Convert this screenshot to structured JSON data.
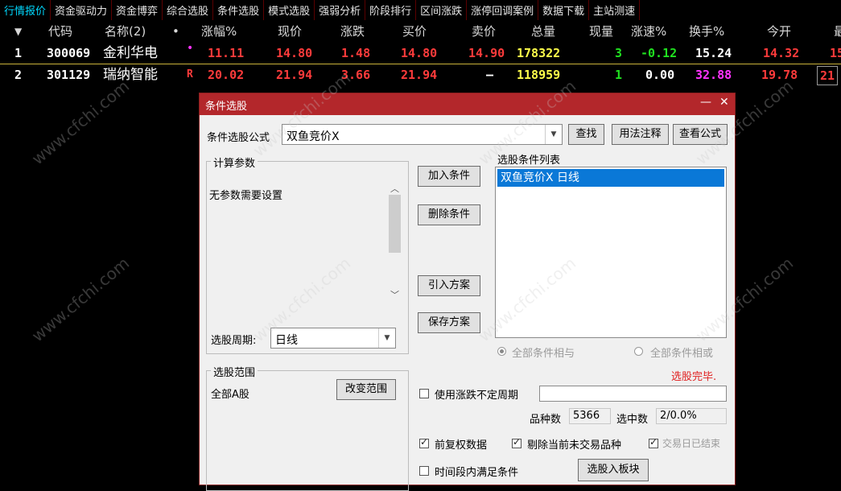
{
  "tabs": [
    "行情报价",
    "资金驱动力",
    "资金博弈",
    "综合选股",
    "条件选股",
    "模式选股",
    "强弱分析",
    "阶段排行",
    "区间涨跌",
    "涨停回调案例",
    "数据下载",
    "主站测速"
  ],
  "quote_table": {
    "sort_arrow": "▼",
    "headers": [
      "代码",
      "名称(2)",
      "•",
      "涨幅%",
      "现价",
      "涨跌",
      "买价",
      "卖价",
      "总量",
      "现量",
      "涨速%",
      "换手%",
      "今开",
      "最"
    ],
    "rows": [
      {
        "no": "1",
        "code": "300069",
        "name": "金利华电",
        "flag": "•",
        "change_pct": "11.11",
        "price": "14.80",
        "change": "1.48",
        "bid": "14.80",
        "ask": "14.90",
        "volume": "178322",
        "cur_vol": "3",
        "speed": "-0.12",
        "turnover": "15.24",
        "open": "14.32",
        "high": "15"
      },
      {
        "no": "2",
        "code": "301129",
        "name": "瑞纳智能",
        "flag": "R",
        "change_pct": "20.02",
        "price": "21.94",
        "change": "3.66",
        "bid": "21.94",
        "ask": "–",
        "volume": "118959",
        "cur_vol": "1",
        "speed": "0.00",
        "turnover": "32.88",
        "open": "19.78",
        "high": "21"
      }
    ]
  },
  "dialog": {
    "title": "条件选股",
    "formula_label": "条件选股公式",
    "formula_value": "双鱼竞价X",
    "find_button": "查找",
    "usage_button": "用法注释",
    "view_formula_button": "查看公式",
    "params_group_title": "计算参数",
    "no_params_text": "无参数需要设置",
    "period_label": "选股周期:",
    "period_value": "日线",
    "add_condition_button": "加入条件",
    "delete_condition_button": "删除条件",
    "import_plan_button": "引入方案",
    "save_plan_button": "保存方案",
    "condition_list_title": "选股条件列表",
    "condition_items": [
      "双鱼竞价X  日线"
    ],
    "radio_and": "全部条件相与",
    "radio_or": "全部条件相或",
    "status_text": "选股完毕.",
    "range_group_title": "选股范围",
    "range_value": "全部A股",
    "change_range_button": "改变范围",
    "use_unfixed_period_label": "使用涨跌不定周期",
    "variety_count_label": "品种数",
    "variety_count_value": "5366",
    "selected_count_label": "选中数",
    "selected_count_value": "2/0.0%",
    "prior_adjust_label": "前复权数据",
    "exclude_untraded_label": "剔除当前未交易品种",
    "third_check_label": "交易日已结束",
    "time_segment_label": "时间段内满足条件",
    "select_to_block_button": "选股入板块"
  },
  "watermark": "www.cfchi.com"
}
